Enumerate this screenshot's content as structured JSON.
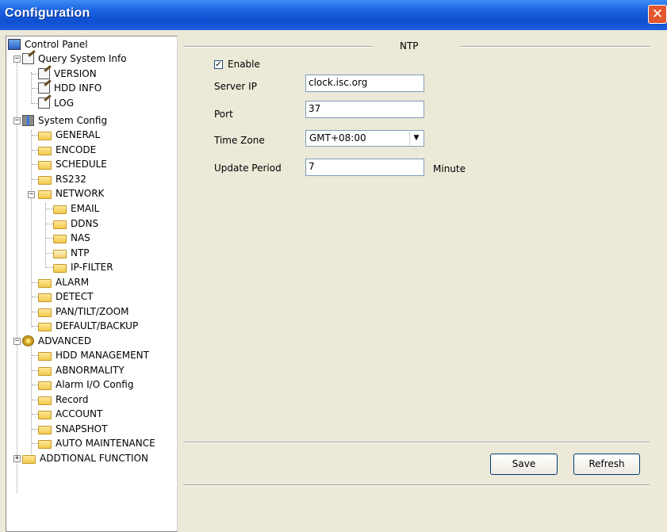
{
  "window": {
    "title": "Configuration",
    "close_glyph": "✕"
  },
  "tree": {
    "root": "Control Panel",
    "query_system_info": "Query System Info",
    "version": "VERSION",
    "hdd_info": "HDD INFO",
    "log": "LOG",
    "system_config": "System Config",
    "general": "GENERAL",
    "encode": "ENCODE",
    "schedule": "SCHEDULE",
    "rs232": "RS232",
    "network": "NETWORK",
    "email": "EMAIL",
    "ddns": "DDNS",
    "nas": "NAS",
    "ntp": "NTP",
    "ip_filter": "IP-FILTER",
    "alarm": "ALARM",
    "detect": "DETECT",
    "ptz": "PAN/TILT/ZOOM",
    "default_backup": "DEFAULT/BACKUP",
    "advanced": "ADVANCED",
    "hdd_management": "HDD MANAGEMENT",
    "abnormality": "ABNORMALITY",
    "alarm_io": "Alarm I/O Config",
    "record": "Record",
    "account": "ACCOUNT",
    "snapshot": "SNAPSHOT",
    "auto_maintenance": "AUTO MAINTENANCE",
    "additional_function": "ADDTIONAL FUNCTION",
    "expand_minus": "−",
    "expand_plus": "+"
  },
  "ntp": {
    "section_title": "NTP",
    "enable_label": "Enable",
    "enable_checked": true,
    "check_glyph": "✓",
    "server_ip_label": "Server IP",
    "server_ip_value": "clock.isc.org",
    "port_label": "Port",
    "port_value": "37",
    "time_zone_label": "Time Zone",
    "time_zone_value": "GMT+08:00",
    "dropdown_glyph": "▼",
    "update_period_label": "Update Period",
    "update_period_value": "7",
    "update_period_unit": "Minute"
  },
  "buttons": {
    "save": "Save",
    "refresh": "Refresh"
  },
  "colors": {
    "titlebar": "#1a62e0",
    "close": "#e2572f",
    "panel": "#ece9d8"
  },
  "icons": {
    "close": "close-icon",
    "computer": "computer-icon",
    "notepad": "notepad-icon",
    "tools": "tools-icon",
    "gear": "gear-icon",
    "folder": "folder-icon",
    "folder_open": "folder-open-icon"
  }
}
